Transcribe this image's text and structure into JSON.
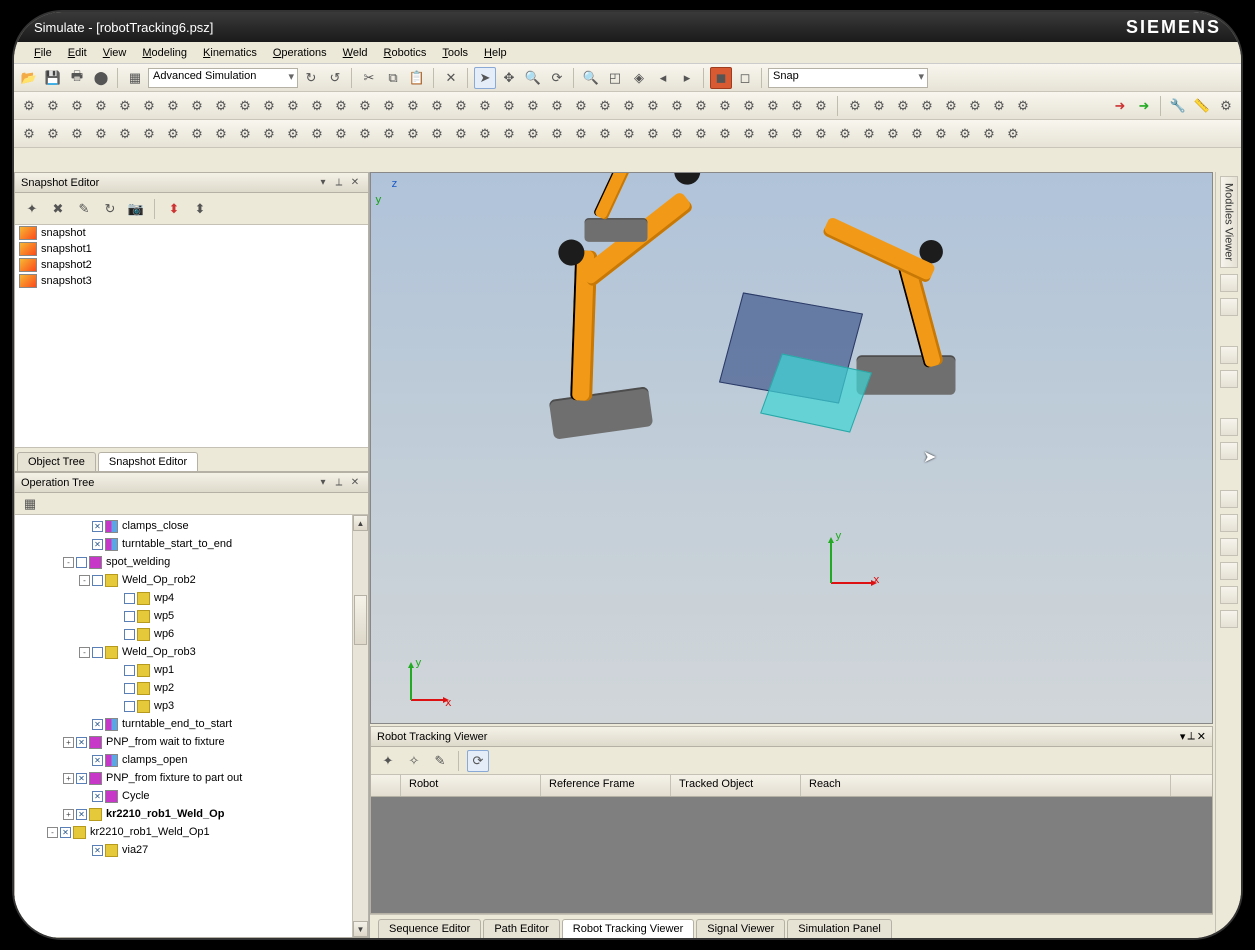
{
  "title": "Simulate - [robotTracking6.psz]",
  "brand": "SIEMENS",
  "menus": [
    "File",
    "Edit",
    "View",
    "Modeling",
    "Kinematics",
    "Operations",
    "Weld",
    "Robotics",
    "Tools",
    "Help"
  ],
  "combo_mode": "Advanced Simulation",
  "combo_snap": "Snap",
  "snapshot_panel": {
    "title": "Snapshot Editor",
    "items": [
      "snapshot",
      "snapshot1",
      "snapshot2",
      "snapshot3"
    ],
    "tabs": [
      "Object Tree",
      "Snapshot Editor"
    ],
    "active_tab": 1
  },
  "operation_panel": {
    "title": "Operation Tree",
    "rows": [
      {
        "indent": 4,
        "exp": "",
        "cb": "checked",
        "ico": "cmp",
        "label": "clamps_close"
      },
      {
        "indent": 4,
        "exp": "",
        "cb": "checked",
        "ico": "cmp",
        "label": "turntable_start_to_end"
      },
      {
        "indent": 3,
        "exp": "-",
        "cb": "",
        "ico": "mag",
        "label": "spot_welding"
      },
      {
        "indent": 4,
        "exp": "-",
        "cb": "",
        "ico": "ylw",
        "label": "Weld_Op_rob2"
      },
      {
        "indent": 6,
        "exp": "",
        "cb": "",
        "ico": "ylw",
        "label": "wp4"
      },
      {
        "indent": 6,
        "exp": "",
        "cb": "",
        "ico": "ylw",
        "label": "wp5"
      },
      {
        "indent": 6,
        "exp": "",
        "cb": "",
        "ico": "ylw",
        "label": "wp6"
      },
      {
        "indent": 4,
        "exp": "-",
        "cb": "",
        "ico": "ylw",
        "label": "Weld_Op_rob3"
      },
      {
        "indent": 6,
        "exp": "",
        "cb": "",
        "ico": "ylw",
        "label": "wp1"
      },
      {
        "indent": 6,
        "exp": "",
        "cb": "",
        "ico": "ylw",
        "label": "wp2"
      },
      {
        "indent": 6,
        "exp": "",
        "cb": "",
        "ico": "ylw",
        "label": "wp3"
      },
      {
        "indent": 4,
        "exp": "",
        "cb": "checked",
        "ico": "cmp",
        "label": "turntable_end_to_start"
      },
      {
        "indent": 3,
        "exp": "+",
        "cb": "checked",
        "ico": "mag",
        "label": "PNP_from wait to fixture"
      },
      {
        "indent": 4,
        "exp": "",
        "cb": "checked",
        "ico": "cmp",
        "label": "clamps_open"
      },
      {
        "indent": 3,
        "exp": "+",
        "cb": "checked",
        "ico": "mag",
        "label": "PNP_from  fixture to part out"
      },
      {
        "indent": 4,
        "exp": "",
        "cb": "checked",
        "ico": "mag",
        "label": "Cycle"
      },
      {
        "indent": 3,
        "exp": "+",
        "cb": "checked",
        "ico": "ylw",
        "label": "kr2210_rob1_Weld_Op",
        "bold": true
      },
      {
        "indent": 2,
        "exp": "-",
        "cb": "checked",
        "ico": "ylw",
        "label": "kr2210_rob1_Weld_Op1"
      },
      {
        "indent": 4,
        "exp": "",
        "cb": "checked",
        "ico": "ylw",
        "label": "via27"
      }
    ]
  },
  "right_tab": "Modules Viewer",
  "rtv": {
    "title": "Robot Tracking Viewer",
    "cols": [
      "Robot",
      "Reference Frame",
      "Tracked Object",
      "Reach"
    ]
  },
  "bottom_tabs": [
    "Sequence Editor",
    "Path Editor",
    "Robot Tracking Viewer",
    "Signal Viewer",
    "Simulation Panel"
  ],
  "bottom_active": 2,
  "axes": {
    "x": "x",
    "y": "y",
    "z": "z"
  }
}
